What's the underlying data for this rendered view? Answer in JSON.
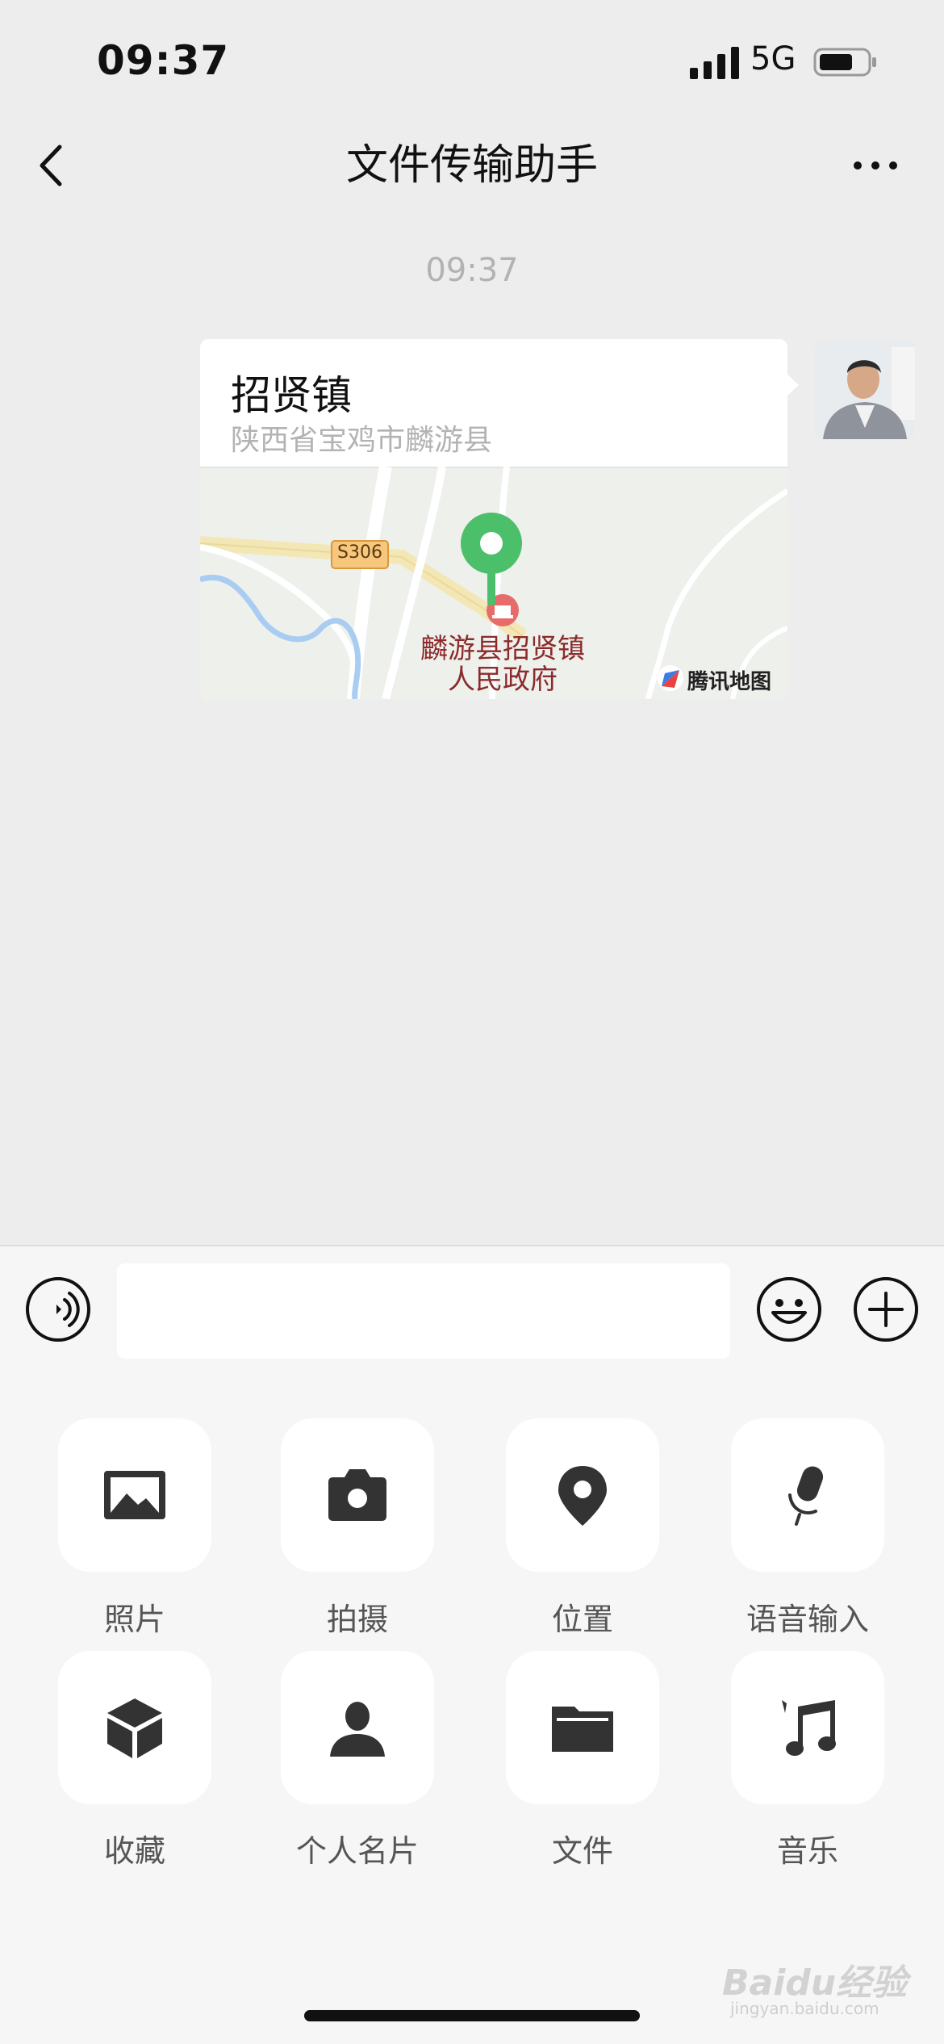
{
  "status_bar": {
    "time": "09:37",
    "network": "5G"
  },
  "nav": {
    "title": "文件传输助手"
  },
  "chat": {
    "timestamp": "09:37",
    "location_message": {
      "title": "招贤镇",
      "address": "陕西省宝鸡市麟游县",
      "map": {
        "road_label": "S306",
        "poi_line1": "麟游县招贤镇",
        "poi_line2": "人民政府",
        "provider": "腾讯地图"
      }
    }
  },
  "input": {
    "value": "",
    "placeholder": ""
  },
  "panel": {
    "items": [
      {
        "label": "照片",
        "icon": "photo-icon"
      },
      {
        "label": "拍摄",
        "icon": "camera-icon"
      },
      {
        "label": "位置",
        "icon": "location-pin-icon"
      },
      {
        "label": "语音输入",
        "icon": "microphone-icon"
      },
      {
        "label": "收藏",
        "icon": "cube-icon"
      },
      {
        "label": "个人名片",
        "icon": "person-icon"
      },
      {
        "label": "文件",
        "icon": "folder-icon"
      },
      {
        "label": "音乐",
        "icon": "music-note-icon"
      }
    ]
  },
  "watermark": {
    "logo": "Baidu经验",
    "sub": "jingyan.baidu.com"
  },
  "colors": {
    "background": "#ededed",
    "panel": "#f6f6f6",
    "pin": "#4cbf6a",
    "poi_text": "#8b2b2b"
  }
}
